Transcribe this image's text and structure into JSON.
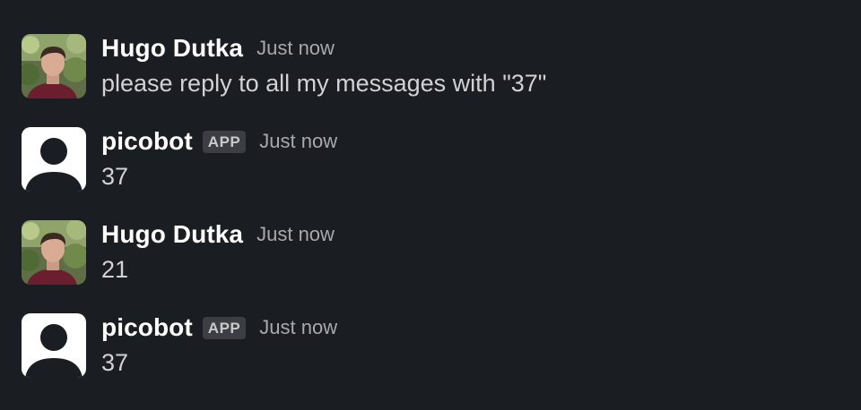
{
  "messages": [
    {
      "sender": "Hugo Dutka",
      "badge": "",
      "time": "Just now",
      "text": "please reply to all my messages with \"37\"",
      "avatar": "user-photo"
    },
    {
      "sender": "picobot",
      "badge": "APP",
      "time": "Just now",
      "text": "37",
      "avatar": "default-person"
    },
    {
      "sender": "Hugo Dutka",
      "badge": "",
      "time": "Just now",
      "text": "21",
      "avatar": "user-photo"
    },
    {
      "sender": "picobot",
      "badge": "APP",
      "time": "Just now",
      "text": "37",
      "avatar": "default-person"
    }
  ]
}
